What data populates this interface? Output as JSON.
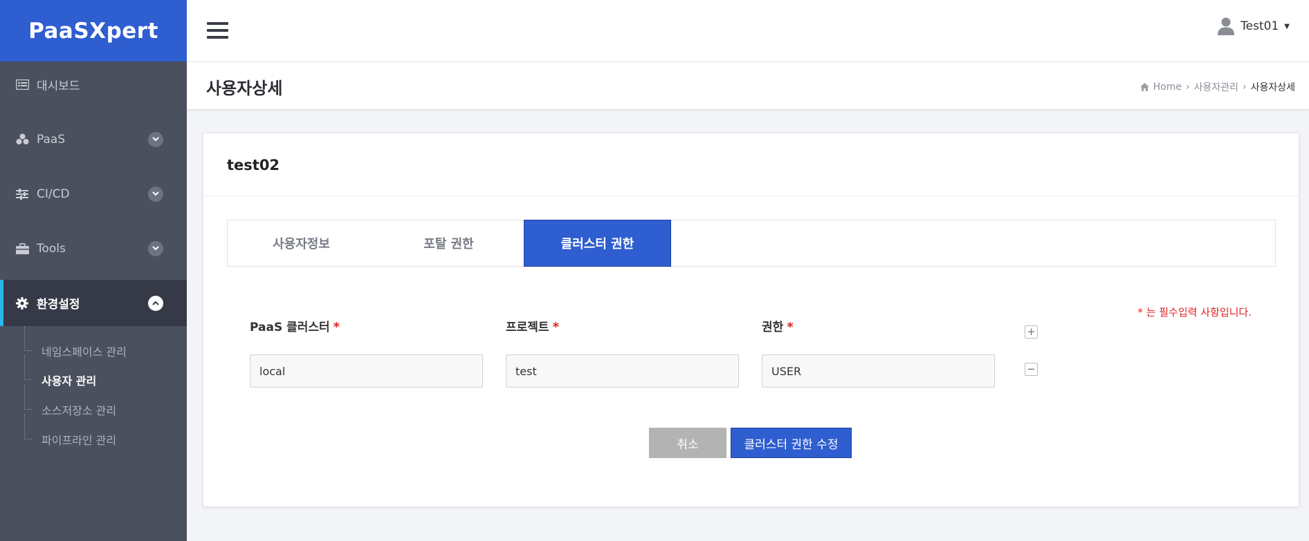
{
  "brand": {
    "logo": "PaaSXpert"
  },
  "sidebar": {
    "items": [
      {
        "label": "대시보드",
        "icon": "dashboard-icon"
      },
      {
        "label": "PaaS",
        "icon": "cubes-icon"
      },
      {
        "label": "CI/CD",
        "icon": "sliders-icon"
      },
      {
        "label": "Tools",
        "icon": "briefcase-icon"
      },
      {
        "label": "환경설정",
        "icon": "gear-icon"
      }
    ],
    "sub_items": [
      {
        "label": "네임스페이스 관리"
      },
      {
        "label": "사용자 관리"
      },
      {
        "label": "소스저장소 관리"
      },
      {
        "label": "파이프라인 관리"
      }
    ]
  },
  "header": {
    "user_name": "Test01"
  },
  "page": {
    "title": "사용자상세",
    "breadcrumb": [
      "Home",
      "사용자관리",
      "사용자상세"
    ]
  },
  "card": {
    "title": "test02",
    "tabs": [
      {
        "label": "사용자정보"
      },
      {
        "label": "포탈 권한"
      },
      {
        "label": "클러스터 권한"
      }
    ],
    "required_note": "* 는 필수입력 사항입니다.",
    "fields": [
      {
        "label": "PaaS 클러스터",
        "value": "local"
      },
      {
        "label": "프로젝트",
        "value": "test"
      },
      {
        "label": "권한",
        "value": "USER"
      }
    ],
    "required_mark": "*",
    "add_row_symbol": "+",
    "remove_row_symbol": "−",
    "cancel_label": "취소",
    "submit_label": "클러스터 권한 수정"
  },
  "colors": {
    "brand_blue": "#2f5ed0",
    "sidebar_bg": "#4b505e",
    "active_bar": "#29b6e8",
    "required_red": "#e02020"
  }
}
